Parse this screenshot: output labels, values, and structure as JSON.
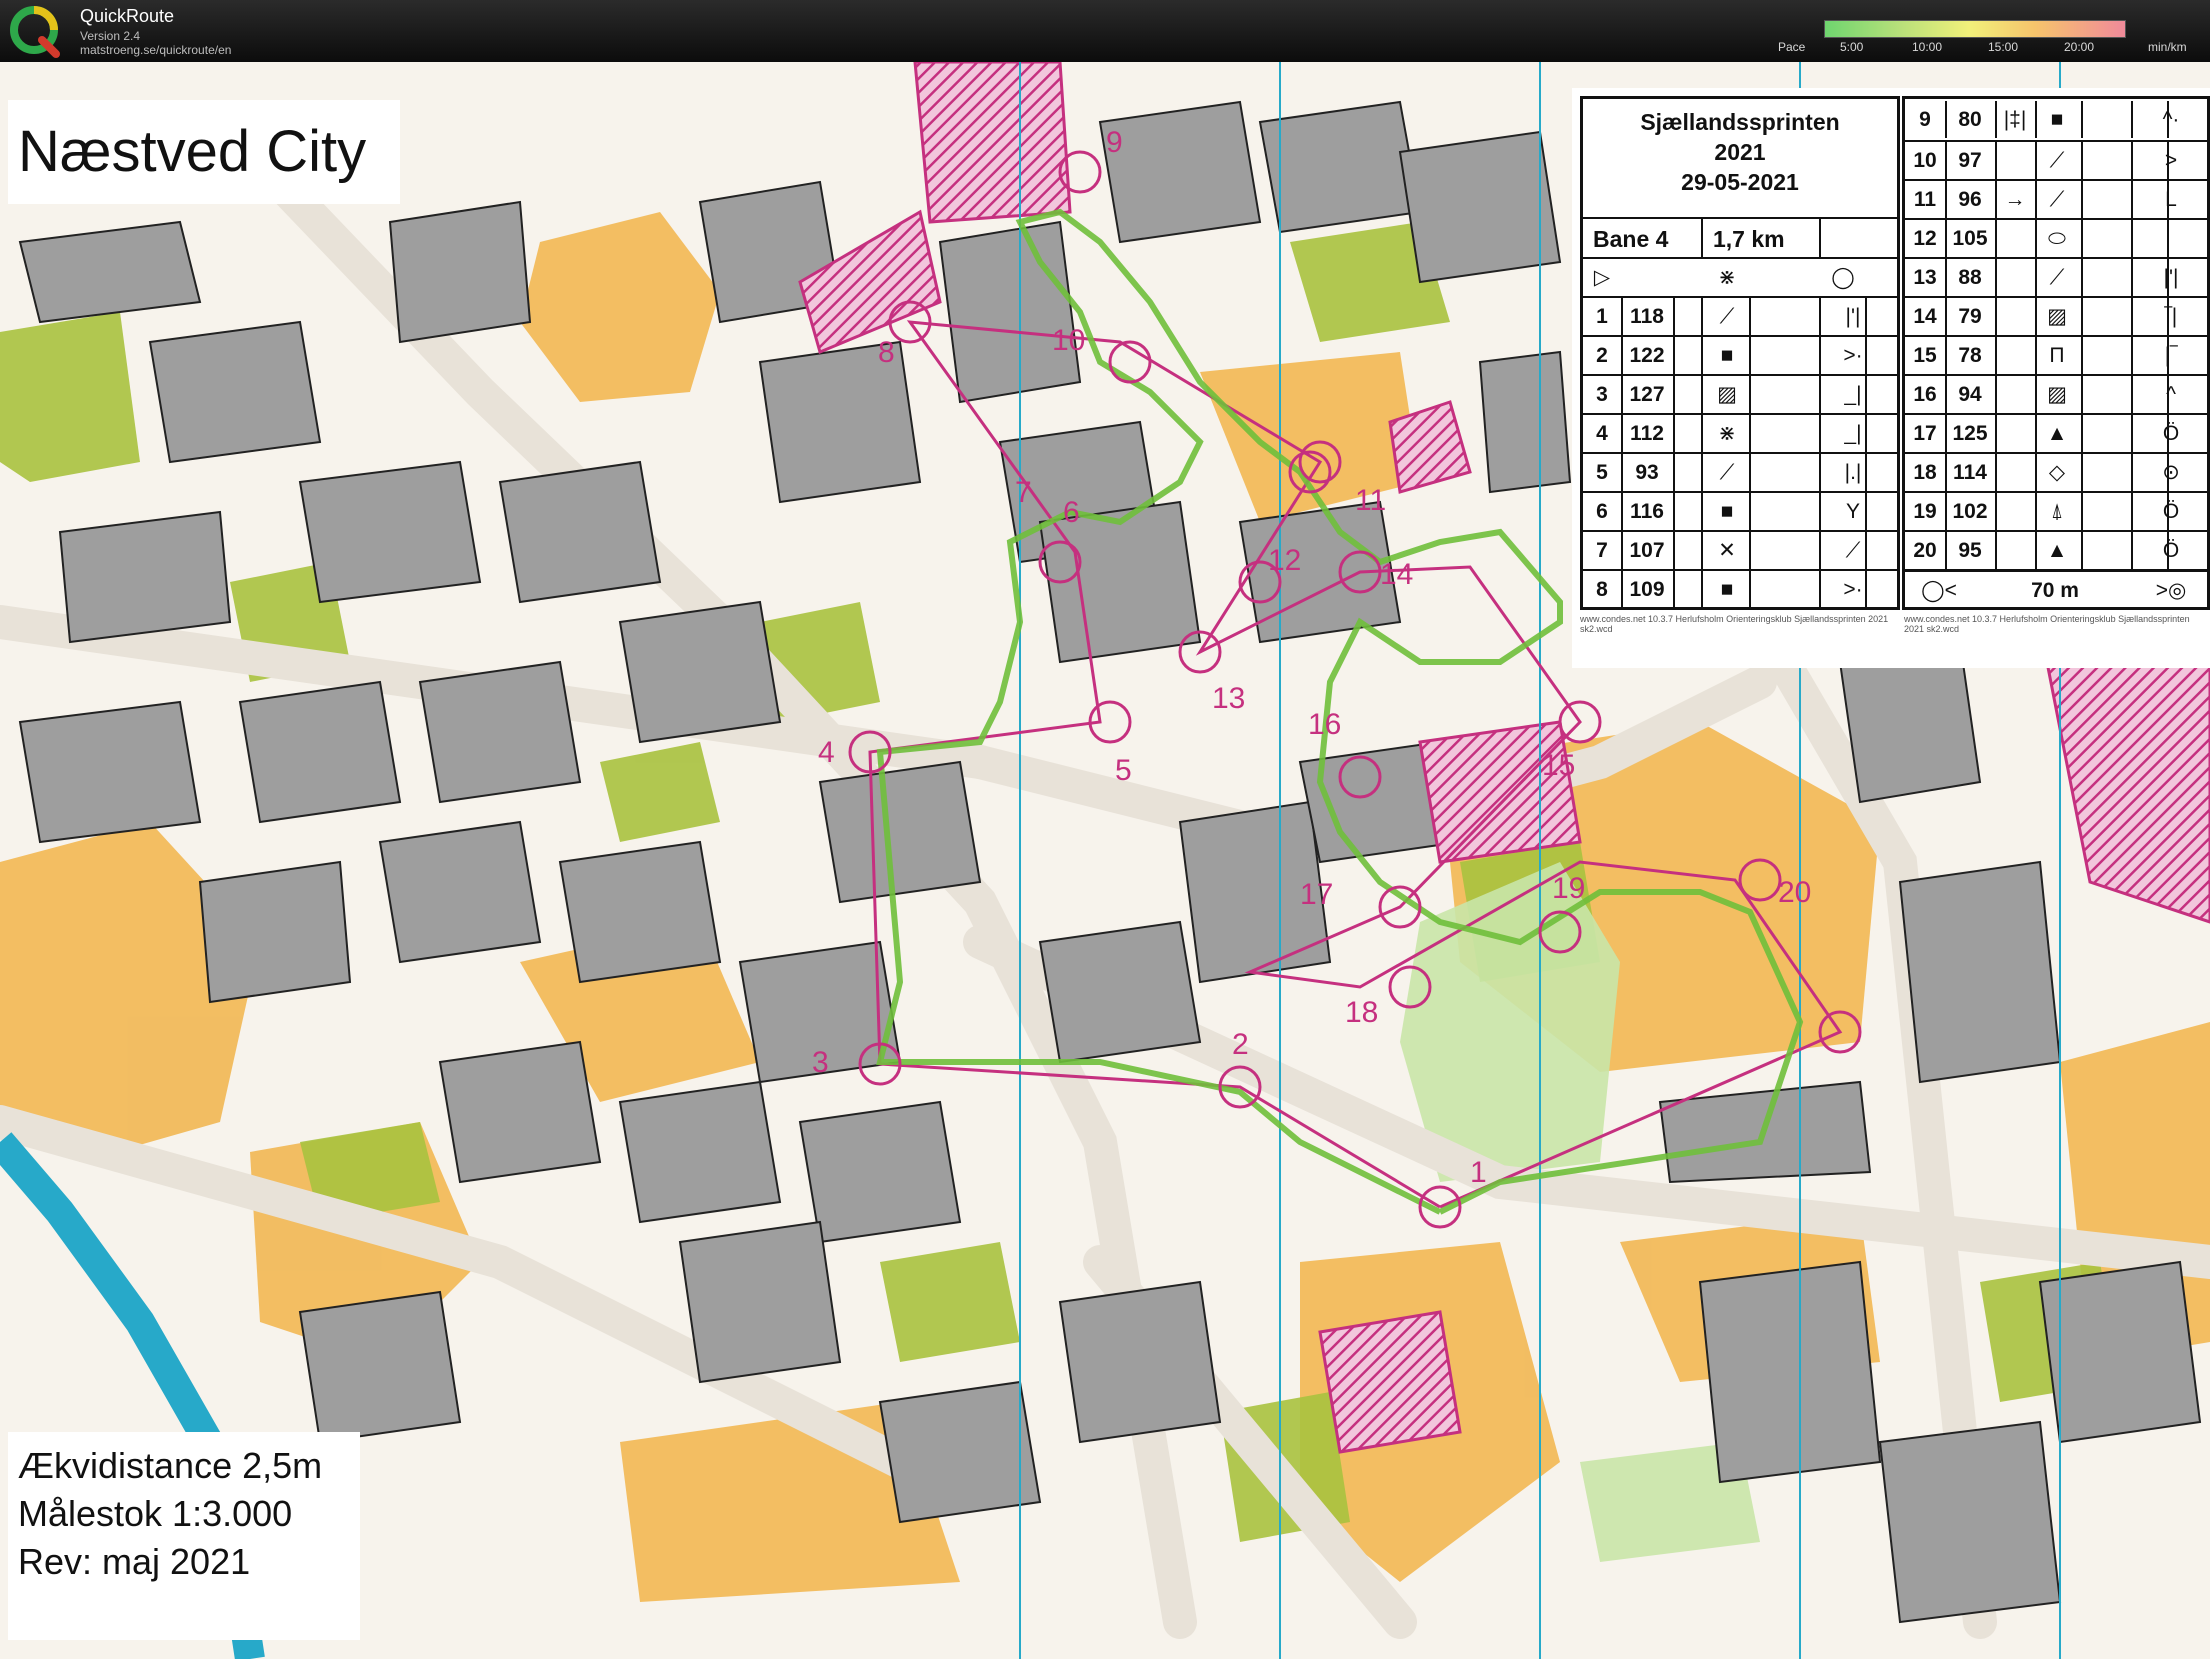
{
  "app": {
    "title": "QuickRoute",
    "version": "Version 2.4",
    "url": "matstroeng.se/quickroute/en"
  },
  "pace_legend": {
    "label": "Pace",
    "ticks": [
      "5:00",
      "10:00",
      "15:00",
      "20:00"
    ],
    "unit": "min/km"
  },
  "map": {
    "title": "Næstved City",
    "equidistance": "Ækvidistance 2,5m",
    "scale": "Målestok 1:3.000",
    "revision": "Rev: maj 2021",
    "colors": {
      "paper": "#f7f3ec",
      "building": "#9e9e9e",
      "open_land": "#f2b44a",
      "green": "#a9c23f",
      "course": "#c5307f",
      "route": "#6fbf3b",
      "water": "#27a9c9"
    },
    "control_labels": [
      "1",
      "2",
      "3",
      "4",
      "5",
      "6",
      "7",
      "8",
      "9",
      "10",
      "11",
      "12",
      "13",
      "14",
      "15",
      "16",
      "17",
      "18",
      "19",
      "20"
    ]
  },
  "description_sheet": {
    "event_name": "Sjællandssprinten",
    "year": "2021",
    "date": "29-05-2021",
    "course": "Bane 4",
    "distance": "1,7 km",
    "start_symbol": "▷",
    "start_feature": "⋇",
    "start_extra": "◯",
    "finish_symbol": "◯<",
    "finish_distance": "70 m",
    "finish_end": ">◎",
    "credit_left": "www.condes.net 10.3.7 Herlufsholm Orienteringsklub Sjællandssprinten 2021 sk2.wcd",
    "credit_right": "www.condes.net 10.3.7 Herlufsholm Orienteringsklub Sjællandssprinten 2021 sk2.wcd",
    "controls_left": [
      {
        "num": "1",
        "code": "118",
        "feature": "⟋",
        "detail": "|'|"
      },
      {
        "num": "2",
        "code": "122",
        "feature": "■",
        "detail": ">·"
      },
      {
        "num": "3",
        "code": "127",
        "feature": "▨",
        "detail": "_|"
      },
      {
        "num": "4",
        "code": "112",
        "feature": "⋇",
        "detail": "_|"
      },
      {
        "num": "5",
        "code": "93",
        "feature": "⟋",
        "detail": "|.|"
      },
      {
        "num": "6",
        "code": "116",
        "feature": "■",
        "detail": "Y"
      },
      {
        "num": "7",
        "code": "107",
        "feature": "✕",
        "detail": "⟋"
      },
      {
        "num": "8",
        "code": "109",
        "feature": "■",
        "detail": ">·"
      }
    ],
    "controls_right": [
      {
        "num": "9",
        "code": "80",
        "prefix": "|‡|",
        "feature": "■",
        "detail": "^·"
      },
      {
        "num": "10",
        "code": "97",
        "prefix": "",
        "feature": "⟋",
        "detail": ">"
      },
      {
        "num": "11",
        "code": "96",
        "prefix": "→",
        "feature": "⟋",
        "detail": "L"
      },
      {
        "num": "12",
        "code": "105",
        "prefix": "",
        "feature": "⬭",
        "detail": ""
      },
      {
        "num": "13",
        "code": "88",
        "prefix": "",
        "feature": "⟋",
        "detail": "|'|"
      },
      {
        "num": "14",
        "code": "79",
        "prefix": "",
        "feature": "▨",
        "detail": "‾|"
      },
      {
        "num": "15",
        "code": "78",
        "prefix": "",
        "feature": "Π",
        "detail": "|‾"
      },
      {
        "num": "16",
        "code": "94",
        "prefix": "",
        "feature": "▨",
        "detail": "^"
      },
      {
        "num": "17",
        "code": "125",
        "prefix": "",
        "feature": "▲",
        "detail": "Ö"
      },
      {
        "num": "18",
        "code": "114",
        "prefix": "",
        "feature": "◇",
        "detail": "⊙"
      },
      {
        "num": "19",
        "code": "102",
        "prefix": "",
        "feature": "⍋",
        "detail": "Ö"
      },
      {
        "num": "20",
        "code": "95",
        "prefix": "",
        "feature": "▲",
        "detail": "Ö"
      }
    ]
  }
}
